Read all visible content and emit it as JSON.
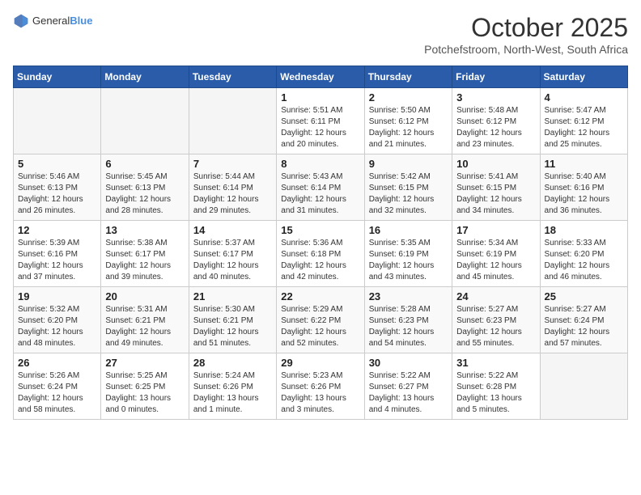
{
  "logo": {
    "text_general": "General",
    "text_blue": "Blue"
  },
  "title": "October 2025",
  "subtitle": "Potchefstroom, North-West, South Africa",
  "days_of_week": [
    "Sunday",
    "Monday",
    "Tuesday",
    "Wednesday",
    "Thursday",
    "Friday",
    "Saturday"
  ],
  "weeks": [
    [
      {
        "day": "",
        "info": ""
      },
      {
        "day": "",
        "info": ""
      },
      {
        "day": "",
        "info": ""
      },
      {
        "day": "1",
        "info": "Sunrise: 5:51 AM\nSunset: 6:11 PM\nDaylight: 12 hours and 20 minutes."
      },
      {
        "day": "2",
        "info": "Sunrise: 5:50 AM\nSunset: 6:12 PM\nDaylight: 12 hours and 21 minutes."
      },
      {
        "day": "3",
        "info": "Sunrise: 5:48 AM\nSunset: 6:12 PM\nDaylight: 12 hours and 23 minutes."
      },
      {
        "day": "4",
        "info": "Sunrise: 5:47 AM\nSunset: 6:12 PM\nDaylight: 12 hours and 25 minutes."
      }
    ],
    [
      {
        "day": "5",
        "info": "Sunrise: 5:46 AM\nSunset: 6:13 PM\nDaylight: 12 hours and 26 minutes."
      },
      {
        "day": "6",
        "info": "Sunrise: 5:45 AM\nSunset: 6:13 PM\nDaylight: 12 hours and 28 minutes."
      },
      {
        "day": "7",
        "info": "Sunrise: 5:44 AM\nSunset: 6:14 PM\nDaylight: 12 hours and 29 minutes."
      },
      {
        "day": "8",
        "info": "Sunrise: 5:43 AM\nSunset: 6:14 PM\nDaylight: 12 hours and 31 minutes."
      },
      {
        "day": "9",
        "info": "Sunrise: 5:42 AM\nSunset: 6:15 PM\nDaylight: 12 hours and 32 minutes."
      },
      {
        "day": "10",
        "info": "Sunrise: 5:41 AM\nSunset: 6:15 PM\nDaylight: 12 hours and 34 minutes."
      },
      {
        "day": "11",
        "info": "Sunrise: 5:40 AM\nSunset: 6:16 PM\nDaylight: 12 hours and 36 minutes."
      }
    ],
    [
      {
        "day": "12",
        "info": "Sunrise: 5:39 AM\nSunset: 6:16 PM\nDaylight: 12 hours and 37 minutes."
      },
      {
        "day": "13",
        "info": "Sunrise: 5:38 AM\nSunset: 6:17 PM\nDaylight: 12 hours and 39 minutes."
      },
      {
        "day": "14",
        "info": "Sunrise: 5:37 AM\nSunset: 6:17 PM\nDaylight: 12 hours and 40 minutes."
      },
      {
        "day": "15",
        "info": "Sunrise: 5:36 AM\nSunset: 6:18 PM\nDaylight: 12 hours and 42 minutes."
      },
      {
        "day": "16",
        "info": "Sunrise: 5:35 AM\nSunset: 6:19 PM\nDaylight: 12 hours and 43 minutes."
      },
      {
        "day": "17",
        "info": "Sunrise: 5:34 AM\nSunset: 6:19 PM\nDaylight: 12 hours and 45 minutes."
      },
      {
        "day": "18",
        "info": "Sunrise: 5:33 AM\nSunset: 6:20 PM\nDaylight: 12 hours and 46 minutes."
      }
    ],
    [
      {
        "day": "19",
        "info": "Sunrise: 5:32 AM\nSunset: 6:20 PM\nDaylight: 12 hours and 48 minutes."
      },
      {
        "day": "20",
        "info": "Sunrise: 5:31 AM\nSunset: 6:21 PM\nDaylight: 12 hours and 49 minutes."
      },
      {
        "day": "21",
        "info": "Sunrise: 5:30 AM\nSunset: 6:21 PM\nDaylight: 12 hours and 51 minutes."
      },
      {
        "day": "22",
        "info": "Sunrise: 5:29 AM\nSunset: 6:22 PM\nDaylight: 12 hours and 52 minutes."
      },
      {
        "day": "23",
        "info": "Sunrise: 5:28 AM\nSunset: 6:23 PM\nDaylight: 12 hours and 54 minutes."
      },
      {
        "day": "24",
        "info": "Sunrise: 5:27 AM\nSunset: 6:23 PM\nDaylight: 12 hours and 55 minutes."
      },
      {
        "day": "25",
        "info": "Sunrise: 5:27 AM\nSunset: 6:24 PM\nDaylight: 12 hours and 57 minutes."
      }
    ],
    [
      {
        "day": "26",
        "info": "Sunrise: 5:26 AM\nSunset: 6:24 PM\nDaylight: 12 hours and 58 minutes."
      },
      {
        "day": "27",
        "info": "Sunrise: 5:25 AM\nSunset: 6:25 PM\nDaylight: 13 hours and 0 minutes."
      },
      {
        "day": "28",
        "info": "Sunrise: 5:24 AM\nSunset: 6:26 PM\nDaylight: 13 hours and 1 minute."
      },
      {
        "day": "29",
        "info": "Sunrise: 5:23 AM\nSunset: 6:26 PM\nDaylight: 13 hours and 3 minutes."
      },
      {
        "day": "30",
        "info": "Sunrise: 5:22 AM\nSunset: 6:27 PM\nDaylight: 13 hours and 4 minutes."
      },
      {
        "day": "31",
        "info": "Sunrise: 5:22 AM\nSunset: 6:28 PM\nDaylight: 13 hours and 5 minutes."
      },
      {
        "day": "",
        "info": ""
      }
    ]
  ]
}
